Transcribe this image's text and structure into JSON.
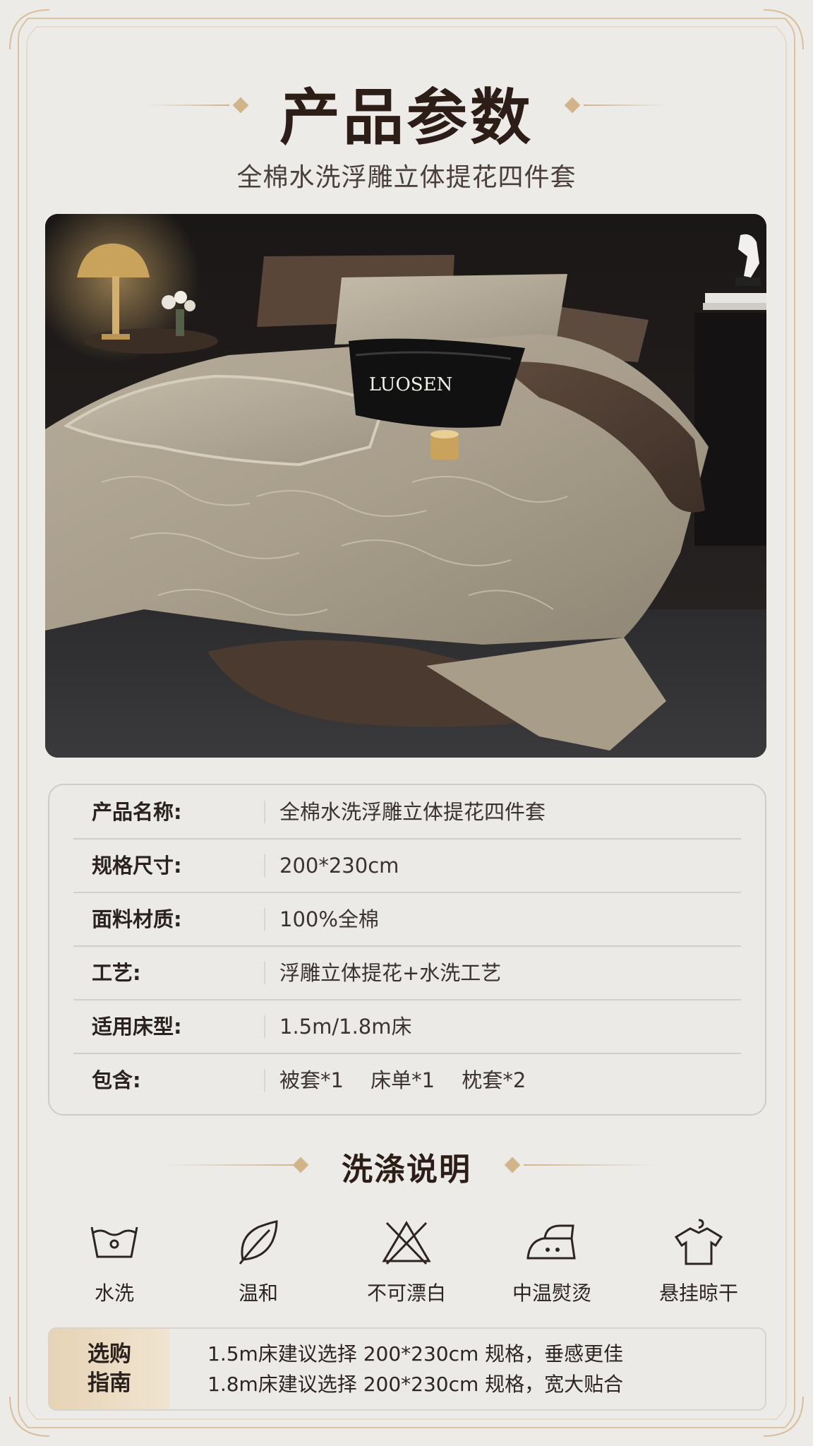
{
  "header": {
    "title": "产品参数",
    "subtitle": "全棉水洗浮雕立体提花四件套"
  },
  "photo": {
    "brand_pillow_text": "LUOSEN"
  },
  "params": [
    {
      "label": "产品名称:",
      "value": "全棉水洗浮雕立体提花四件套"
    },
    {
      "label": "规格尺寸:",
      "value": "200*230cm"
    },
    {
      "label": "面料材质:",
      "value": "100%全棉"
    },
    {
      "label": "工艺:",
      "value": "浮雕立体提花+水洗工艺"
    },
    {
      "label": "适用床型:",
      "value": "1.5m/1.8m床"
    },
    {
      "label": "包含:",
      "value": "被套*1　 床单*1　 枕套*2"
    }
  ],
  "care": {
    "title": "洗涤说明",
    "items": [
      {
        "icon": "wash-basin-icon",
        "label": "水洗"
      },
      {
        "icon": "leaf-icon",
        "label": "温和"
      },
      {
        "icon": "no-bleach-icon",
        "label": "不可漂白"
      },
      {
        "icon": "iron-icon",
        "label": "中温熨烫"
      },
      {
        "icon": "hanging-shirt-icon",
        "label": "悬挂晾干"
      }
    ]
  },
  "guide": {
    "title_line1": "选购",
    "title_line2": "指南",
    "lines": [
      "1.5m床建议选择 200*230cm 规格，垂感更佳",
      "1.8m床建议选择 200*230cm 规格，宽大贴合"
    ]
  },
  "colors": {
    "background": "#ecebe8",
    "gold_accent": "#d2b48a",
    "title_text": "#2c1d16"
  }
}
